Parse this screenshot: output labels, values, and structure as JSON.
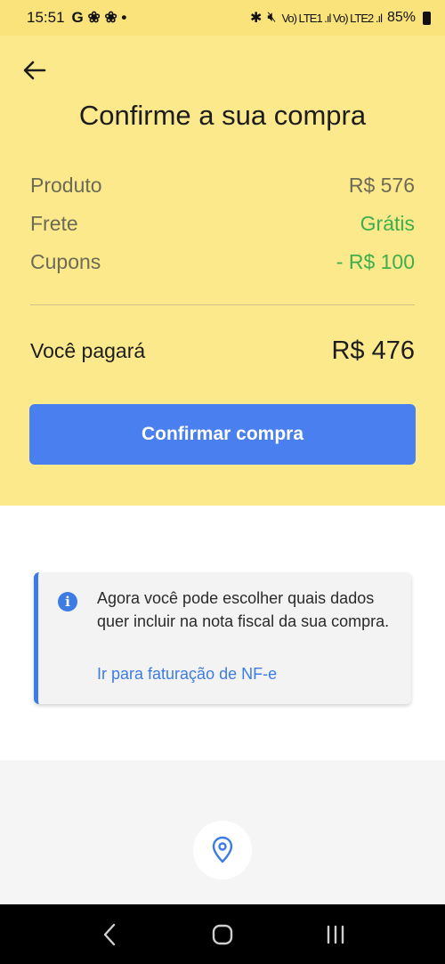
{
  "status_bar": {
    "time": "15:51",
    "left_icons": "G ❀ ❀ •",
    "signal": "Vo) LTE1 .ıl  Vo) LTE2 .ıl",
    "battery": "85%"
  },
  "header": {
    "back_icon": "arrow-left-icon",
    "title": "Confirme a sua compra"
  },
  "summary": {
    "rows": [
      {
        "label": "Produto",
        "value": "R$ 576"
      },
      {
        "label": "Frete",
        "value": "Grátis"
      },
      {
        "label": "Cupons",
        "value": "- R$ 100"
      }
    ],
    "total_label": "Você pagará",
    "total_value": "R$ 476"
  },
  "confirm_button": "Confirmar compra",
  "info_card": {
    "icon": "info-icon",
    "text": "Agora você pode escolher quais dados quer incluir na nota fiscal da sua compra.",
    "link": "Ir para faturação de NF-e"
  },
  "location_button": {
    "icon": "location-pin-icon"
  },
  "nav": {
    "back_icon": "nav-back-icon",
    "home_icon": "nav-home-icon",
    "recents_icon": "nav-recents-icon"
  },
  "colors": {
    "yellow": "#fbe98b",
    "accent_blue": "#4a7ff0",
    "green": "#3fae4d"
  }
}
